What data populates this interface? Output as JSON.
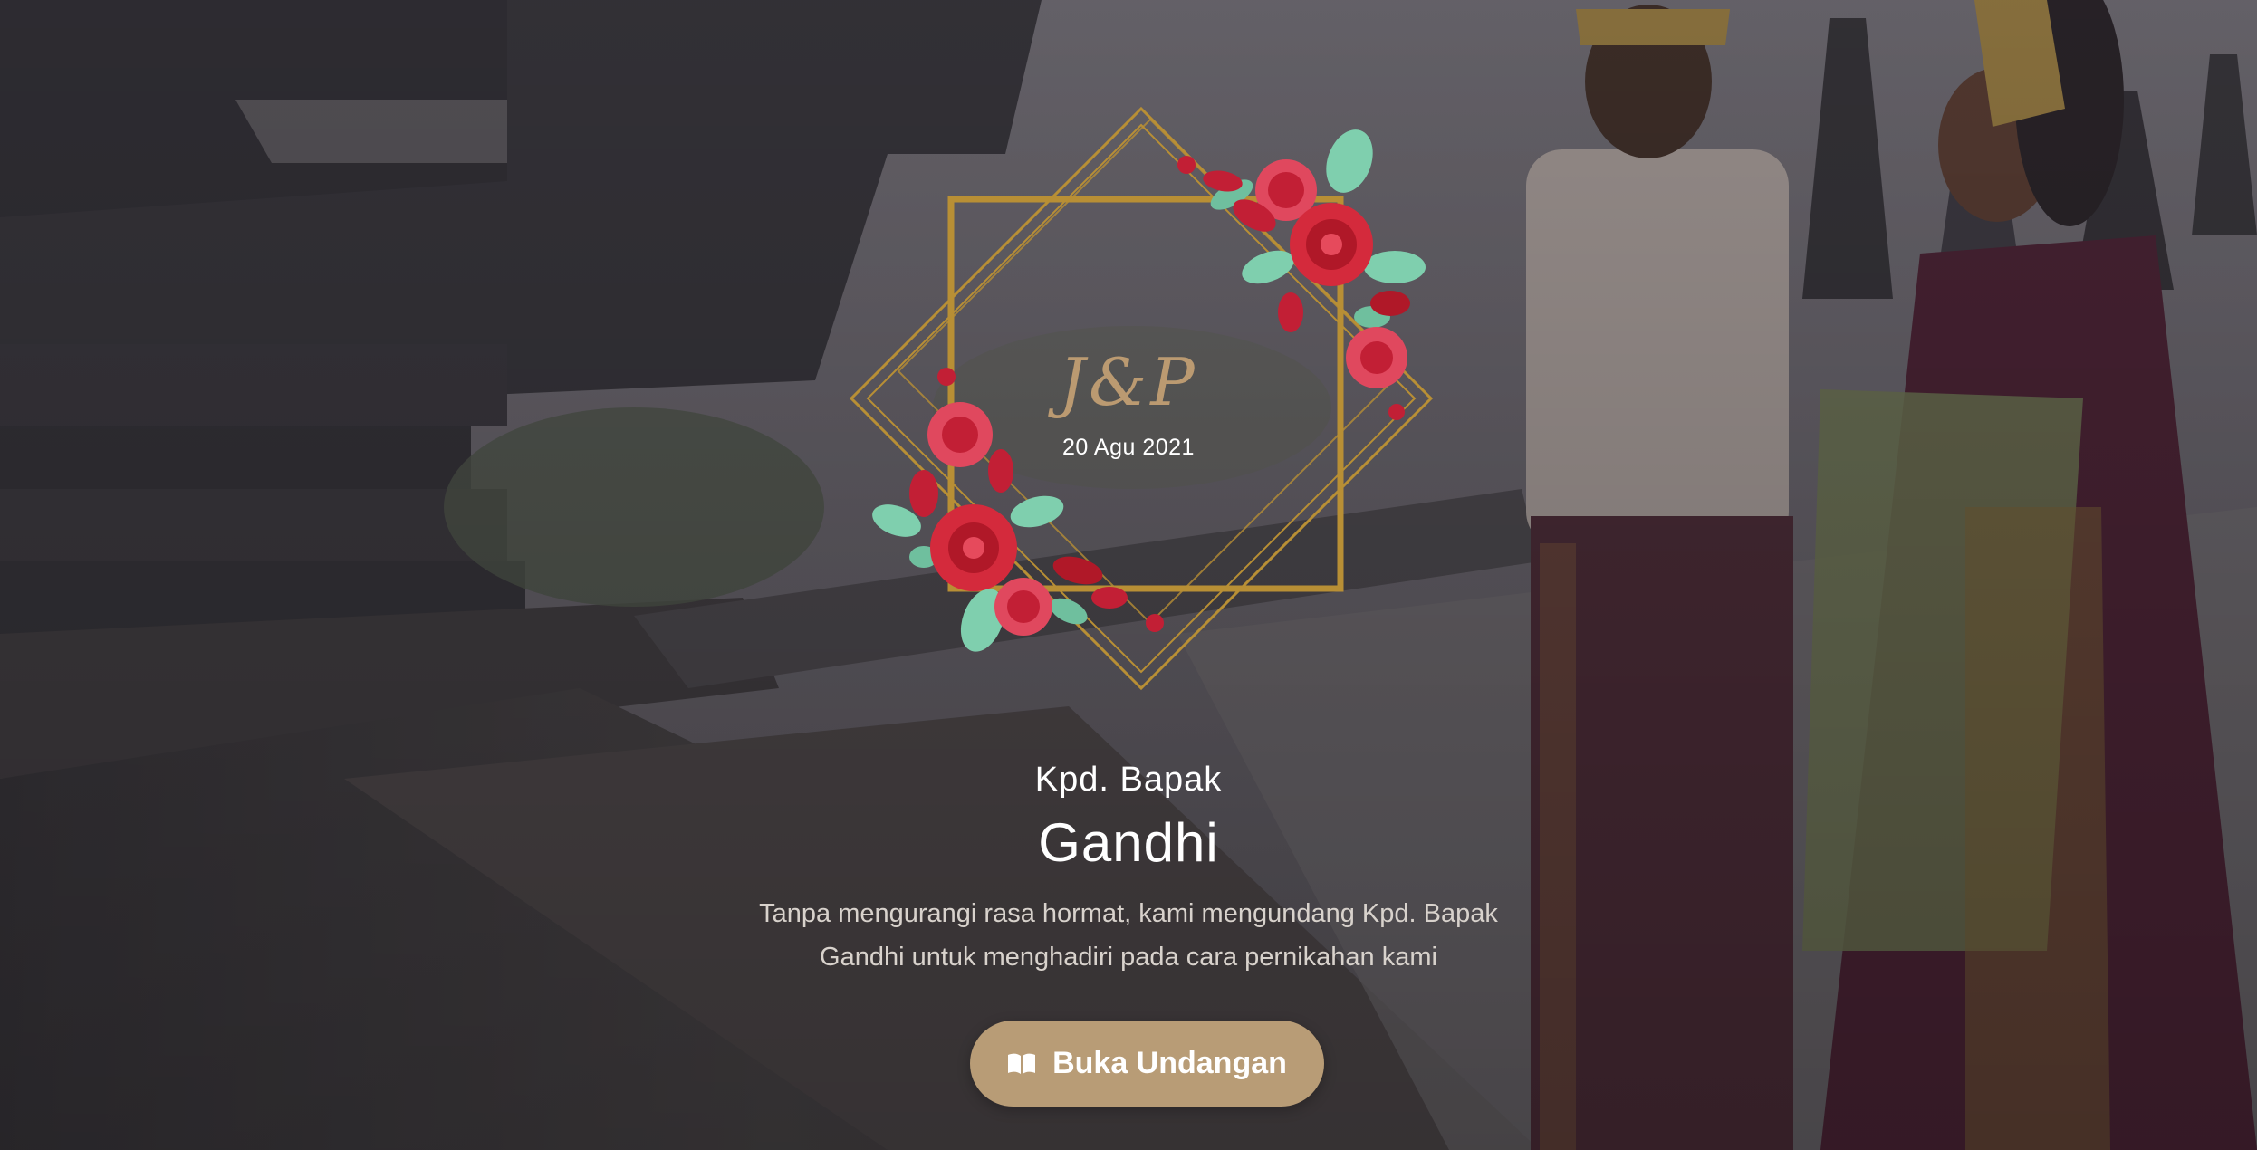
{
  "colors": {
    "gold": "#b88f35",
    "accent_button": "#b89c76",
    "monogram": "#c4a174",
    "rose": "#d42a3c",
    "leaf": "#7fcfae"
  },
  "cover": {
    "monogram": "J&P",
    "date": "20 Agu 2021"
  },
  "guest": {
    "prefix": "Kpd. Bapak",
    "name": "Gandhi"
  },
  "message": "Tanpa mengurangi rasa hormat, kami mengundang Kpd. Bapak Gandhi untuk menghadiri pada cara pernikahan kami",
  "open_button": {
    "icon": "book-open-icon",
    "label": "Buka Undangan"
  }
}
